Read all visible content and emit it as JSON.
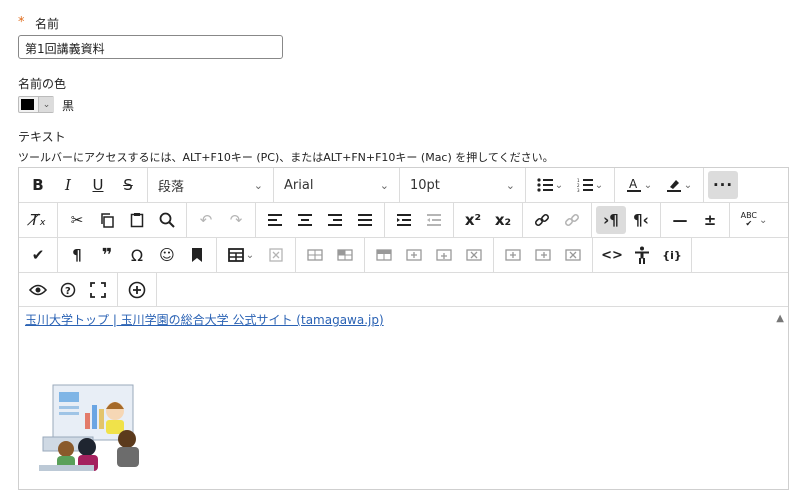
{
  "form": {
    "required_mark": "*",
    "name_label": "名前",
    "name_value": "第1回講義資料",
    "color_label": "名前の色",
    "color_name": "黒",
    "color_value": "#000000",
    "text_label": "テキスト",
    "toolbar_hint": "ツールバーにアクセスするには、ALT+F10キー (PC)、またはALT+FN+F10キー (Mac) を押してください。"
  },
  "toolbar": {
    "paragraph_style": "段落",
    "font_family": "Arial",
    "font_size": "10pt",
    "spellcheck_label": "ABC",
    "code_label": "<>",
    "math_label": "{i}"
  },
  "editor": {
    "link_text": "玉川大学トップ | 玉川学園の総合大学 公式サイト (tamagawa.jp)"
  },
  "colors": {
    "accent_required": "#e06b1b",
    "link": "#2a62b4",
    "active_button": "#dcdcdc"
  }
}
